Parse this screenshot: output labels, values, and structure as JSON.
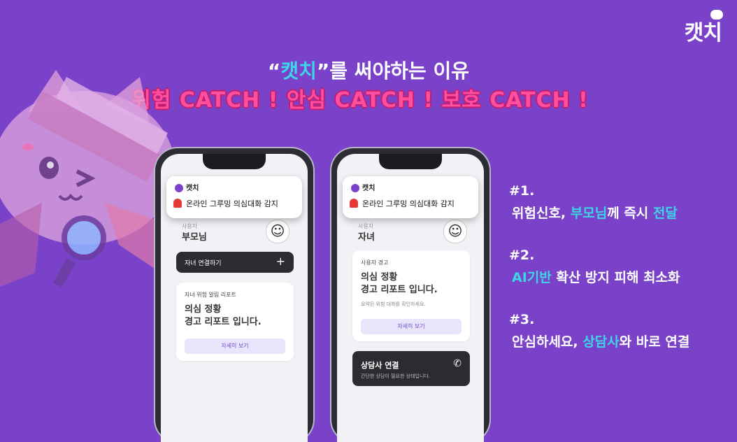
{
  "logo": {
    "text": "캣치"
  },
  "heading": {
    "quote_open": "“",
    "brand": "캣치",
    "quote_close": "”",
    "rest": "를 써야하는 이유",
    "subtitle": "위험 CATCH ! 안심 CATCH ! 보호 CATCH !"
  },
  "phone_left": {
    "notification": {
      "app_name": "캣치",
      "message": "온라인 그루밍 의심대화 감지"
    },
    "user_role": "사용자",
    "user_name": "부모님",
    "connect_button": {
      "label": "자녀 연결하기",
      "icon": "plus-icon"
    },
    "report_card": {
      "caption": "자녀 위험 알림 리포트",
      "line1": "의심 정황",
      "line2": "경고 리포트 입니다.",
      "button": "자세히 보기"
    }
  },
  "phone_right": {
    "notification": {
      "app_name": "캣치",
      "message": "온라인 그루밍 의심대화 감지"
    },
    "user_role": "사용자",
    "user_name": "자녀",
    "warning_card": {
      "caption": "사용자 경고",
      "line1": "의심 정황",
      "line2": "경고 리포트 입니다.",
      "hint": "요약된 위험 대화를 확인하세요.",
      "button": "자세히 보기"
    },
    "counsel_card": {
      "title": "상담사 연결",
      "subtitle": "간단한 상담이 필요한 상태입니다.",
      "icon": "phone-icon"
    }
  },
  "reasons": [
    {
      "num": "#1.",
      "pre": "위험신호, ",
      "hl1": "부모님",
      "mid": "께 즉시 ",
      "hl2": "전달",
      "post": ""
    },
    {
      "num": "#2.",
      "pre": "",
      "hl1": "AI기반",
      "mid": " 확산 방지 피해 최소화",
      "hl2": "",
      "post": ""
    },
    {
      "num": "#3.",
      "pre": "안심하세요, ",
      "hl1": "상담사",
      "mid": "와 바로 연결",
      "hl2": "",
      "post": ""
    }
  ],
  "colors": {
    "background": "#7a42c8",
    "accent_cyan": "#3fd3e8",
    "accent_pink": "#ff4fa0"
  }
}
